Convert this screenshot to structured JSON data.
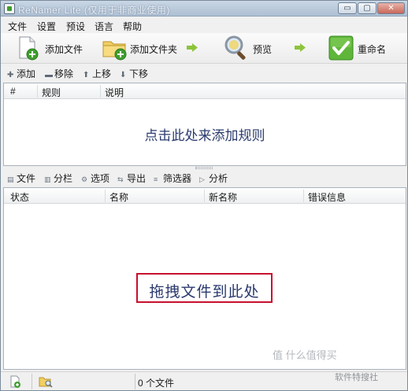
{
  "window": {
    "title": "ReNamer Lite (仅用于非商业使用)",
    "controls": {
      "minimize": "▭",
      "maximize": "▢",
      "close": "✕"
    }
  },
  "menu": [
    "文件",
    "设置",
    "预设",
    "语言",
    "帮助"
  ],
  "toolbar": {
    "add_files": "添加文件",
    "add_folder": "添加文件夹",
    "preview": "预览",
    "rename": "重命名"
  },
  "rules_toolbar": {
    "add": "添加",
    "remove": "移除",
    "up": "上移",
    "down": "下移"
  },
  "rules_table": {
    "columns": [
      "#",
      "规则",
      "说明"
    ],
    "empty_hint": "点击此处来添加规则"
  },
  "files_toolbar": {
    "files": "文件",
    "columns": "分栏",
    "options": "选项",
    "export": "导出",
    "filters": "筛选器",
    "analyze": "分析"
  },
  "files_table": {
    "columns": [
      "状态",
      "名称",
      "新名称",
      "错误信息"
    ],
    "drop_hint": "拖拽文件到此处"
  },
  "statusbar": {
    "file_count": "0 个文件"
  },
  "watermark": {
    "brand": "值 什么值得买",
    "source": "软件特搜社"
  },
  "colors": {
    "accent_green": "#3f9d2f",
    "hint_text": "#2a3a6e",
    "drop_border": "#c8102e"
  }
}
